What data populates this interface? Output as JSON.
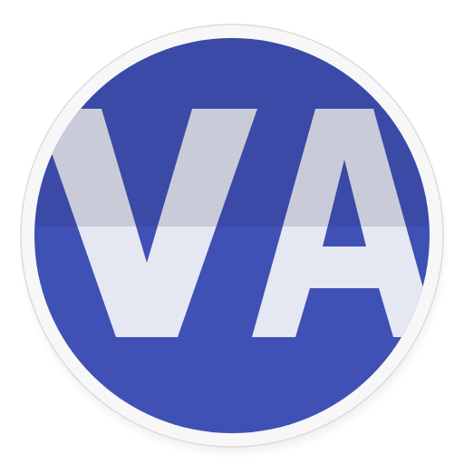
{
  "icon": {
    "name": "VA app icon",
    "logo_text": "VA",
    "colors": {
      "rim": "#f7f7f7",
      "rim_edge": "#dcdcdc",
      "circle_top": "#3b4aa6",
      "circle_bottom": "#3f51b5",
      "letters_top": "#c9ccd8",
      "letters_bottom": "#e5e7f2"
    }
  }
}
